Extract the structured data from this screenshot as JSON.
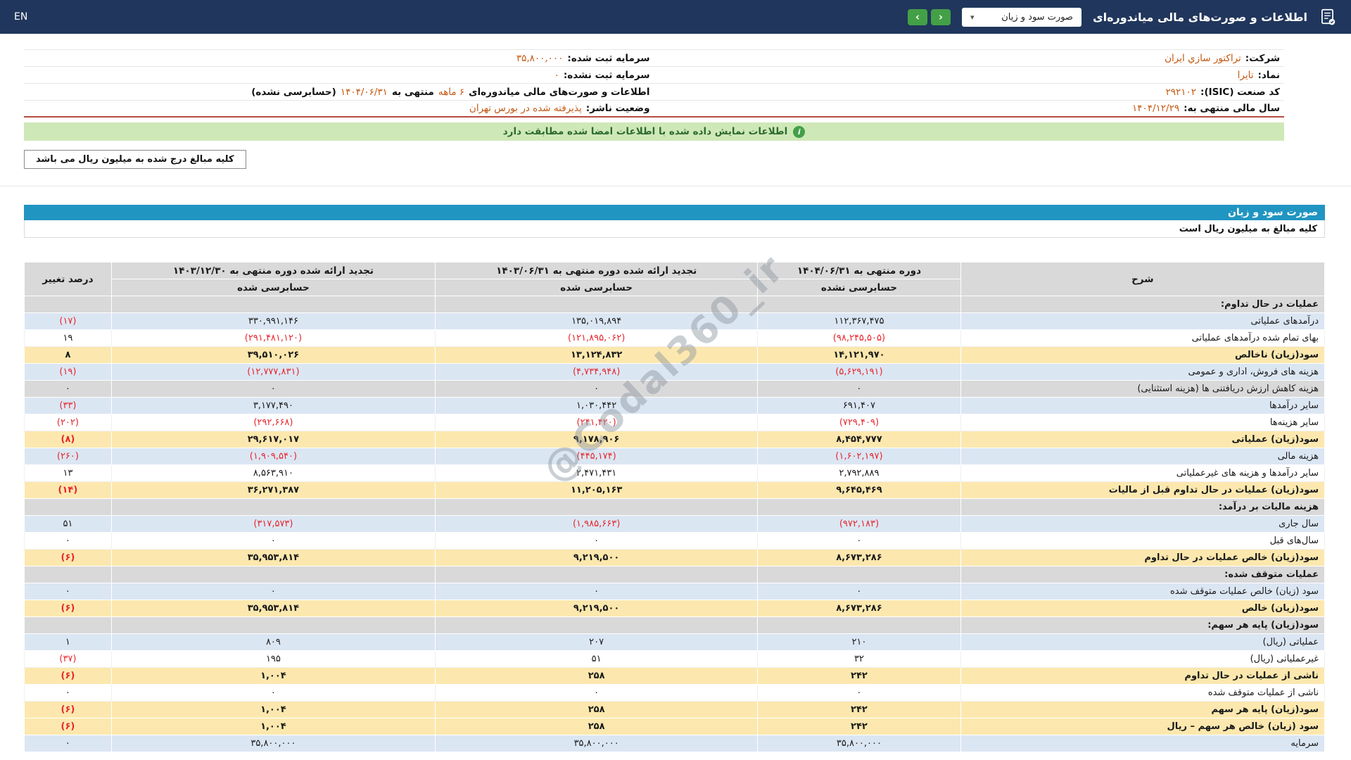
{
  "colors": {
    "c-topbar": "#20365c",
    "c-green": "#43a047",
    "c-blue-bar": "#2095c2",
    "c-row-blue": "#dbe6f3",
    "c-row-yellow": "#fce8ae",
    "c-gray": "#d9d9d9",
    "c-red": "#e8262d",
    "c-orange": "#c45911",
    "c-banner-bg": "#cfe8b8",
    "c-banner-text": "#2c6b2f",
    "c-redline": "#b74c41",
    "c-watermark": "#8c96a0"
  },
  "topbar": {
    "title": "اطلاعات و صورت‌های مالی میاندوره‌ای",
    "dropdown_value": "صورت سود و زیان",
    "caret_icon": "▾",
    "nav_prev_icon": "‹",
    "nav_next_icon": "›",
    "en_label": "EN"
  },
  "company_info": {
    "company_label": "شرکت:",
    "company_value": "تراکتور سازي ایران",
    "symbol_label": "نماد:",
    "symbol_value": "تایرا",
    "isic_label": "کد صنعت (ISIC):",
    "isic_value": "۲۹۲۱۰۲",
    "fiscal_year_label": "سال مالی منتهی به:",
    "fiscal_year_value": "۱۴۰۴/۱۲/۲۹",
    "registered_capital_label": "سرمایه ثبت شده:",
    "registered_capital_value": "۳۵,۸۰۰,۰۰۰",
    "unregistered_capital_label": "سرمایه ثبت نشده:",
    "unregistered_capital_value": "۰",
    "period_line": {
      "prefix": "اطلاعات و صورت‌های مالی میاندوره‌ای",
      "duration": "۶ ماهه",
      "middle": "منتهی به",
      "date": "۱۴۰۴/۰۶/۳۱",
      "suffix": "(حسابرسی نشده)"
    },
    "publisher_status_label": "وضعیت ناشر:",
    "publisher_status_value": "پذیرفته شده در بورس تهران"
  },
  "banner": {
    "icon": "i",
    "text": "اطلاعات نمایش داده شده با اطلاعات امضا شده مطابقت دارد"
  },
  "notes": {
    "amounts_note": "کلیه مبالغ درج شده به میلیون ریال می باشد"
  },
  "statement": {
    "title": "صورت سود و زیان",
    "units_note": "کلیه مبالغ به میلیون ریال است"
  },
  "watermark": "@Codal360_ir",
  "table": {
    "col_desc": "شرح",
    "col_pct": "درصد تغییر",
    "periods": [
      {
        "title": "دوره منتهی به ۱۴۰۴/۰۶/۳۱",
        "audit": "حسابرسی نشده"
      },
      {
        "title": "تجدید ارائه شده دوره منتهی به ۱۴۰۳/۰۶/۳۱",
        "audit": "حسابرسی شده"
      },
      {
        "title": "تجدید ارائه شده دوره منتهی به ۱۴۰۳/۱۲/۳۰",
        "audit": "حسابرسی شده"
      }
    ],
    "rows": [
      {
        "label": "عملیات در حال تداوم:",
        "v1": "",
        "v2": "",
        "v3": "",
        "pct": "",
        "bg": "section"
      },
      {
        "label": "درآمدهای عملیاتی",
        "v1": "۱۱۲,۳۶۷,۴۷۵",
        "v2": "۱۳۵,۰۱۹,۸۹۴",
        "v3": "۳۳۰,۹۹۱,۱۴۶",
        "pct": "(۱۷)",
        "bg": "blue"
      },
      {
        "label": "بهای تمام شده درآمدهای عملیاتی",
        "v1": "(۹۸,۲۴۵,۵۰۵)",
        "v2": "(۱۲۱,۸۹۵,۰۶۲)",
        "v3": "(۲۹۱,۴۸۱,۱۲۰)",
        "pct": "۱۹",
        "bg": "white"
      },
      {
        "label": "سود(زیان) ناخالص",
        "v1": "۱۴,۱۲۱,۹۷۰",
        "v2": "۱۳,۱۲۴,۸۳۲",
        "v3": "۳۹,۵۱۰,۰۲۶",
        "pct": "۸",
        "bg": "yellow"
      },
      {
        "label": "هزینه های فروش، اداری و عمومی",
        "v1": "(۵,۶۲۹,۱۹۱)",
        "v2": "(۴,۷۳۴,۹۴۸)",
        "v3": "(۱۲,۷۷۷,۸۳۱)",
        "pct": "(۱۹)",
        "bg": "blue"
      },
      {
        "label": "هزینه کاهش ارزش دریافتنی ها (هزینه استثنایی)",
        "v1": "۰",
        "v2": "۰",
        "v3": "۰",
        "pct": "۰",
        "bg": "gray"
      },
      {
        "label": "سایر درآمدها",
        "v1": "۶۹۱,۴۰۷",
        "v2": "۱,۰۳۰,۴۴۲",
        "v3": "۳,۱۷۷,۴۹۰",
        "pct": "(۳۳)",
        "bg": "blue"
      },
      {
        "label": "سایر هزینه‌ها",
        "v1": "(۷۲۹,۴۰۹)",
        "v2": "(۲۴۱,۴۲۰)",
        "v3": "(۲۹۲,۶۶۸)",
        "pct": "(۲۰۲)",
        "bg": "white"
      },
      {
        "label": "سود(زیان) عملیاتی",
        "v1": "۸,۴۵۴,۷۷۷",
        "v2": "۹,۱۷۸,۹۰۶",
        "v3": "۲۹,۶۱۷,۰۱۷",
        "pct": "(۸)",
        "bg": "yellow"
      },
      {
        "label": "هزینه مالی",
        "v1": "(۱,۶۰۲,۱۹۷)",
        "v2": "(۴۴۵,۱۷۴)",
        "v3": "(۱,۹۰۹,۵۴۰)",
        "pct": "(۲۶۰)",
        "bg": "blue"
      },
      {
        "label": "سایر درآمدها و هزینه های غیرعملیاتی",
        "v1": "۲,۷۹۲,۸۸۹",
        "v2": "۲,۴۷۱,۴۳۱",
        "v3": "۸,۵۶۳,۹۱۰",
        "pct": "۱۳",
        "bg": "white"
      },
      {
        "label": "سود(زیان) عملیات در حال تداوم قبل از مالیات",
        "v1": "۹,۶۴۵,۴۶۹",
        "v2": "۱۱,۲۰۵,۱۶۳",
        "v3": "۳۶,۲۷۱,۳۸۷",
        "pct": "(۱۴)",
        "bg": "yellow"
      },
      {
        "label": "هزینه مالیات بر درآمد:",
        "v1": "",
        "v2": "",
        "v3": "",
        "pct": "",
        "bg": "section"
      },
      {
        "label": "سال جاری",
        "v1": "(۹۷۲,۱۸۳)",
        "v2": "(۱,۹۸۵,۶۶۳)",
        "v3": "(۳۱۷,۵۷۳)",
        "pct": "۵۱",
        "bg": "blue"
      },
      {
        "label": "سال‌های قبل",
        "v1": "۰",
        "v2": "۰",
        "v3": "۰",
        "pct": "۰",
        "bg": "white"
      },
      {
        "label": "سود(زیان) خالص عملیات در حال تداوم",
        "v1": "۸,۶۷۳,۲۸۶",
        "v2": "۹,۲۱۹,۵۰۰",
        "v3": "۳۵,۹۵۳,۸۱۴",
        "pct": "(۶)",
        "bg": "yellow"
      },
      {
        "label": "عملیات متوقف شده:",
        "v1": "",
        "v2": "",
        "v3": "",
        "pct": "",
        "bg": "section"
      },
      {
        "label": "سود (زیان) خالص عملیات متوقف شده",
        "v1": "۰",
        "v2": "۰",
        "v3": "۰",
        "pct": "۰",
        "bg": "blue"
      },
      {
        "label": "سود(زیان) خالص",
        "v1": "۸,۶۷۳,۲۸۶",
        "v2": "۹,۲۱۹,۵۰۰",
        "v3": "۳۵,۹۵۳,۸۱۴",
        "pct": "(۶)",
        "bg": "yellow"
      },
      {
        "label": "سود(زیان) پایه هر سهم:",
        "v1": "",
        "v2": "",
        "v3": "",
        "pct": "",
        "bg": "section"
      },
      {
        "label": "عملیاتی (ریال)",
        "v1": "۲۱۰",
        "v2": "۲۰۷",
        "v3": "۸۰۹",
        "pct": "۱",
        "bg": "blue"
      },
      {
        "label": "غیرعملیاتی (ریال)",
        "v1": "۳۲",
        "v2": "۵۱",
        "v3": "۱۹۵",
        "pct": "(۳۷)",
        "bg": "white"
      },
      {
        "label": "ناشی از عملیات در حال تداوم",
        "v1": "۲۴۲",
        "v2": "۲۵۸",
        "v3": "۱,۰۰۴",
        "pct": "(۶)",
        "bg": "yellow"
      },
      {
        "label": "ناشی از عملیات متوقف شده",
        "v1": "۰",
        "v2": "۰",
        "v3": "۰",
        "pct": "۰",
        "bg": "white"
      },
      {
        "label": "سود(زیان) پایه هر سهم",
        "v1": "۲۴۲",
        "v2": "۲۵۸",
        "v3": "۱,۰۰۴",
        "pct": "(۶)",
        "bg": "yellow"
      },
      {
        "label": "سود (زیان) خالص هر سهم – ریال",
        "v1": "۲۴۲",
        "v2": "۲۵۸",
        "v3": "۱,۰۰۴",
        "pct": "(۶)",
        "bg": "yellow"
      },
      {
        "label": "سرمایه",
        "v1": "۳۵,۸۰۰,۰۰۰",
        "v2": "۳۵,۸۰۰,۰۰۰",
        "v3": "۳۵,۸۰۰,۰۰۰",
        "pct": "۰",
        "bg": "blue"
      }
    ]
  }
}
